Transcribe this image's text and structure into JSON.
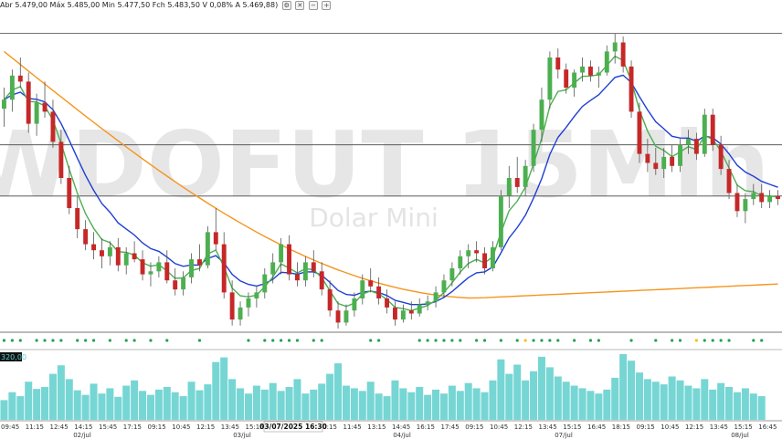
{
  "header": {
    "ohlc_text": "Abr 5.479,00 Máx 5.485,00 Min 5.477,50 Fch 5.483,50 V 0,08% A 5.469,88)",
    "buttons": [
      {
        "name": "settings-icon",
        "glyph": "⚙"
      },
      {
        "name": "close-icon",
        "glyph": "✕"
      },
      {
        "name": "minus-icon",
        "glyph": "−"
      },
      {
        "name": "plus-icon",
        "glyph": "+"
      }
    ]
  },
  "watermark": {
    "symbol": "WDOFUT 15Min",
    "name": "Dolar Mini"
  },
  "volume_label": "320,00",
  "crosshair_label": "03/07/2025 16:30",
  "colors": {
    "up": "#4caf50",
    "down": "#c62828",
    "ma_fast": "#4caf50",
    "ma_mid": "#1e3fd4",
    "ma_slow": "#f5951d",
    "volume": "#5ecfcc",
    "dots": "#22a053",
    "dot_alt": "#f2c21b"
  },
  "chart_data": {
    "type": "candlestick",
    "price_range": [
      0,
      100
    ],
    "levels": [
      98,
      61,
      44
    ],
    "candles": [
      {
        "o": 73,
        "h": 80,
        "l": 67,
        "c": 76
      },
      {
        "o": 76,
        "h": 86,
        "l": 72,
        "c": 84
      },
      {
        "o": 84,
        "h": 90,
        "l": 80,
        "c": 82
      },
      {
        "o": 82,
        "h": 85,
        "l": 65,
        "c": 68
      },
      {
        "o": 68,
        "h": 78,
        "l": 64,
        "c": 75
      },
      {
        "o": 75,
        "h": 82,
        "l": 70,
        "c": 72
      },
      {
        "o": 72,
        "h": 76,
        "l": 60,
        "c": 62
      },
      {
        "o": 62,
        "h": 66,
        "l": 48,
        "c": 50
      },
      {
        "o": 50,
        "h": 54,
        "l": 38,
        "c": 40
      },
      {
        "o": 40,
        "h": 44,
        "l": 30,
        "c": 33
      },
      {
        "o": 33,
        "h": 36,
        "l": 26,
        "c": 28
      },
      {
        "o": 28,
        "h": 32,
        "l": 23,
        "c": 26
      },
      {
        "o": 26,
        "h": 30,
        "l": 20,
        "c": 24
      },
      {
        "o": 24,
        "h": 29,
        "l": 21,
        "c": 27
      },
      {
        "o": 27,
        "h": 30,
        "l": 19,
        "c": 21
      },
      {
        "o": 21,
        "h": 27,
        "l": 18,
        "c": 25
      },
      {
        "o": 25,
        "h": 29,
        "l": 22,
        "c": 23
      },
      {
        "o": 23,
        "h": 26,
        "l": 16,
        "c": 18
      },
      {
        "o": 18,
        "h": 22,
        "l": 14,
        "c": 19
      },
      {
        "o": 19,
        "h": 24,
        "l": 17,
        "c": 22
      },
      {
        "o": 22,
        "h": 26,
        "l": 15,
        "c": 16
      },
      {
        "o": 16,
        "h": 20,
        "l": 11,
        "c": 13
      },
      {
        "o": 13,
        "h": 19,
        "l": 11,
        "c": 17
      },
      {
        "o": 17,
        "h": 25,
        "l": 15,
        "c": 23
      },
      {
        "o": 23,
        "h": 28,
        "l": 19,
        "c": 21
      },
      {
        "o": 21,
        "h": 34,
        "l": 20,
        "c": 32
      },
      {
        "o": 32,
        "h": 40,
        "l": 26,
        "c": 28
      },
      {
        "o": 28,
        "h": 32,
        "l": 10,
        "c": 12
      },
      {
        "o": 12,
        "h": 16,
        "l": 1,
        "c": 3
      },
      {
        "o": 3,
        "h": 9,
        "l": 1,
        "c": 7
      },
      {
        "o": 7,
        "h": 12,
        "l": 4,
        "c": 10
      },
      {
        "o": 10,
        "h": 14,
        "l": 7,
        "c": 12
      },
      {
        "o": 12,
        "h": 20,
        "l": 10,
        "c": 18
      },
      {
        "o": 18,
        "h": 25,
        "l": 15,
        "c": 22
      },
      {
        "o": 22,
        "h": 30,
        "l": 18,
        "c": 28
      },
      {
        "o": 28,
        "h": 31,
        "l": 16,
        "c": 18
      },
      {
        "o": 18,
        "h": 22,
        "l": 14,
        "c": 16
      },
      {
        "o": 16,
        "h": 24,
        "l": 14,
        "c": 22
      },
      {
        "o": 22,
        "h": 26,
        "l": 17,
        "c": 19
      },
      {
        "o": 19,
        "h": 22,
        "l": 11,
        "c": 13
      },
      {
        "o": 13,
        "h": 16,
        "l": 4,
        "c": 6
      },
      {
        "o": 6,
        "h": 9,
        "l": 0,
        "c": 2
      },
      {
        "o": 2,
        "h": 8,
        "l": 1,
        "c": 6
      },
      {
        "o": 6,
        "h": 12,
        "l": 4,
        "c": 10
      },
      {
        "o": 10,
        "h": 18,
        "l": 8,
        "c": 16
      },
      {
        "o": 16,
        "h": 20,
        "l": 12,
        "c": 14
      },
      {
        "o": 14,
        "h": 17,
        "l": 8,
        "c": 10
      },
      {
        "o": 10,
        "h": 13,
        "l": 5,
        "c": 7
      },
      {
        "o": 7,
        "h": 9,
        "l": 1,
        "c": 3
      },
      {
        "o": 3,
        "h": 8,
        "l": 2,
        "c": 6
      },
      {
        "o": 6,
        "h": 9,
        "l": 3,
        "c": 5
      },
      {
        "o": 5,
        "h": 10,
        "l": 4,
        "c": 8
      },
      {
        "o": 8,
        "h": 11,
        "l": 6,
        "c": 9
      },
      {
        "o": 9,
        "h": 14,
        "l": 7,
        "c": 12
      },
      {
        "o": 12,
        "h": 18,
        "l": 10,
        "c": 16
      },
      {
        "o": 16,
        "h": 22,
        "l": 14,
        "c": 20
      },
      {
        "o": 20,
        "h": 26,
        "l": 18,
        "c": 24
      },
      {
        "o": 24,
        "h": 28,
        "l": 20,
        "c": 26
      },
      {
        "o": 26,
        "h": 29,
        "l": 22,
        "c": 25
      },
      {
        "o": 25,
        "h": 27,
        "l": 18,
        "c": 20
      },
      {
        "o": 20,
        "h": 29,
        "l": 19,
        "c": 27
      },
      {
        "o": 27,
        "h": 46,
        "l": 26,
        "c": 44
      },
      {
        "o": 44,
        "h": 54,
        "l": 40,
        "c": 50
      },
      {
        "o": 50,
        "h": 57,
        "l": 45,
        "c": 47
      },
      {
        "o": 47,
        "h": 56,
        "l": 44,
        "c": 54
      },
      {
        "o": 54,
        "h": 68,
        "l": 52,
        "c": 66
      },
      {
        "o": 66,
        "h": 80,
        "l": 62,
        "c": 76
      },
      {
        "o": 76,
        "h": 92,
        "l": 73,
        "c": 90
      },
      {
        "o": 90,
        "h": 93,
        "l": 83,
        "c": 86
      },
      {
        "o": 86,
        "h": 88,
        "l": 78,
        "c": 80
      },
      {
        "o": 80,
        "h": 86,
        "l": 77,
        "c": 85
      },
      {
        "o": 85,
        "h": 90,
        "l": 82,
        "c": 87
      },
      {
        "o": 87,
        "h": 89,
        "l": 82,
        "c": 84
      },
      {
        "o": 84,
        "h": 87,
        "l": 80,
        "c": 85
      },
      {
        "o": 85,
        "h": 94,
        "l": 84,
        "c": 92
      },
      {
        "o": 92,
        "h": 98,
        "l": 88,
        "c": 95
      },
      {
        "o": 95,
        "h": 97,
        "l": 85,
        "c": 87
      },
      {
        "o": 87,
        "h": 89,
        "l": 70,
        "c": 72
      },
      {
        "o": 72,
        "h": 75,
        "l": 55,
        "c": 58
      },
      {
        "o": 58,
        "h": 63,
        "l": 52,
        "c": 55
      },
      {
        "o": 55,
        "h": 60,
        "l": 51,
        "c": 53
      },
      {
        "o": 53,
        "h": 60,
        "l": 50,
        "c": 57
      },
      {
        "o": 57,
        "h": 61,
        "l": 52,
        "c": 54
      },
      {
        "o": 54,
        "h": 63,
        "l": 52,
        "c": 61
      },
      {
        "o": 61,
        "h": 66,
        "l": 58,
        "c": 63
      },
      {
        "o": 63,
        "h": 65,
        "l": 56,
        "c": 58
      },
      {
        "o": 58,
        "h": 73,
        "l": 57,
        "c": 71
      },
      {
        "o": 71,
        "h": 73,
        "l": 59,
        "c": 61
      },
      {
        "o": 61,
        "h": 64,
        "l": 51,
        "c": 53
      },
      {
        "o": 53,
        "h": 56,
        "l": 43,
        "c": 45
      },
      {
        "o": 45,
        "h": 48,
        "l": 37,
        "c": 39
      },
      {
        "o": 39,
        "h": 45,
        "l": 35,
        "c": 43
      },
      {
        "o": 43,
        "h": 48,
        "l": 41,
        "c": 45
      },
      {
        "o": 45,
        "h": 48,
        "l": 40,
        "c": 42
      },
      {
        "o": 42,
        "h": 46,
        "l": 40,
        "c": 44
      },
      {
        "o": 44,
        "h": 46,
        "l": 41,
        "c": 43
      }
    ],
    "volume": [
      30,
      42,
      36,
      58,
      47,
      50,
      70,
      83,
      62,
      45,
      38,
      55,
      40,
      48,
      35,
      52,
      60,
      44,
      38,
      46,
      50,
      42,
      36,
      58,
      45,
      54,
      88,
      95,
      62,
      48,
      40,
      52,
      46,
      56,
      44,
      50,
      62,
      40,
      46,
      55,
      70,
      86,
      52,
      48,
      44,
      58,
      40,
      36,
      60,
      48,
      42,
      50,
      38,
      46,
      40,
      52,
      44,
      56,
      48,
      42,
      60,
      92,
      70,
      84,
      60,
      74,
      96,
      80,
      66,
      58,
      52,
      48,
      44,
      40,
      46,
      64,
      100,
      90,
      72,
      62,
      58,
      54,
      66,
      60,
      52,
      48,
      62,
      46,
      56,
      50,
      42,
      48,
      40,
      36
    ],
    "x_ticks": [
      "09:45",
      "11:15",
      "12:45",
      "14:15",
      "15:45",
      "17:15",
      "09:15",
      "10:45",
      "12:15",
      "13:45",
      "15:15",
      "16:45",
      "18:15",
      "10:15",
      "11:45",
      "13:15",
      "14:45",
      "16:15",
      "17:45",
      "09:15",
      "10:45",
      "12:15",
      "13:45",
      "15:15",
      "16:45",
      "18:15",
      "09:15",
      "10:45",
      "12:15",
      "13:45",
      "15:15",
      "16:45"
    ],
    "date_labels": [
      "02/jul",
      "03/jul",
      "04/jul",
      "07/jul",
      "08/jul"
    ],
    "signal_dots": [
      1,
      1,
      1,
      0,
      1,
      1,
      1,
      1,
      0,
      1,
      1,
      1,
      0,
      1,
      0,
      1,
      1,
      0,
      1,
      0,
      1,
      0,
      0,
      0,
      1,
      0,
      0,
      0,
      0,
      0,
      1,
      0,
      1,
      1,
      1,
      1,
      1,
      0,
      1,
      1,
      0,
      0,
      0,
      0,
      0,
      1,
      1,
      0,
      0,
      0,
      0,
      1,
      1,
      1,
      1,
      1,
      1,
      0,
      1,
      1,
      0,
      1,
      0,
      1,
      2,
      1,
      1,
      1,
      1,
      0,
      1,
      0,
      1,
      1,
      0,
      0,
      0,
      1,
      0,
      0,
      1,
      0,
      1,
      1,
      0,
      2,
      1,
      1,
      1,
      1,
      0,
      0,
      1,
      1
    ]
  }
}
